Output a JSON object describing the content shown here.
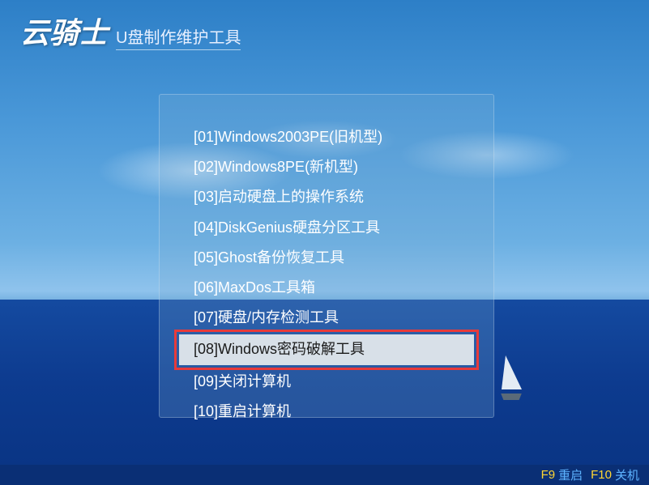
{
  "header": {
    "logo": "云骑士",
    "subtitle": "U盘制作维护工具"
  },
  "menu": {
    "items": [
      {
        "label": "[01]Windows2003PE(旧机型)",
        "selected": false
      },
      {
        "label": "[02]Windows8PE(新机型)",
        "selected": false
      },
      {
        "label": "[03]启动硬盘上的操作系统",
        "selected": false
      },
      {
        "label": "[04]DiskGenius硬盘分区工具",
        "selected": false
      },
      {
        "label": "[05]Ghost备份恢复工具",
        "selected": false
      },
      {
        "label": "[06]MaxDos工具箱",
        "selected": false
      },
      {
        "label": "[07]硬盘/内存检测工具",
        "selected": false
      },
      {
        "label": "[08]Windows密码破解工具",
        "selected": true
      },
      {
        "label": "[09]关闭计算机",
        "selected": false
      },
      {
        "label": "[10]重启计算机",
        "selected": false
      }
    ]
  },
  "footer": {
    "key1": "F9",
    "action1": "重启",
    "key2": "F10",
    "action2": "关机"
  }
}
